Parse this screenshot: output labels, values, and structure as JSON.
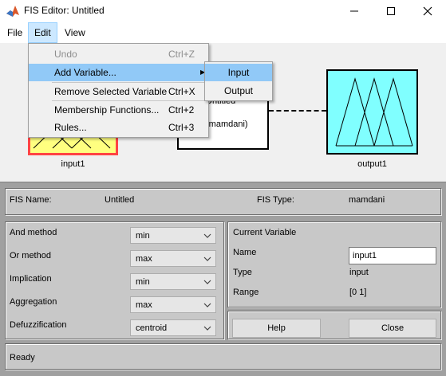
{
  "window": {
    "title": "FIS Editor: Untitled"
  },
  "menubar": {
    "file": "File",
    "edit": "Edit",
    "view": "View"
  },
  "edit_menu": {
    "items": [
      {
        "label": "Undo",
        "shortcut": "Ctrl+Z",
        "disabled": true
      },
      {
        "label": "Add Variable...",
        "shortcut": "",
        "submenu_arrow": "▶"
      },
      {
        "label": "Remove Selected Variable",
        "shortcut": "Ctrl+X"
      },
      {
        "label": "Membership Functions...",
        "shortcut": "Ctrl+2"
      },
      {
        "label": "Rules...",
        "shortcut": "Ctrl+3"
      }
    ]
  },
  "add_variable_submenu": {
    "items": [
      "Input",
      "Output"
    ]
  },
  "diagram": {
    "input_label": "input1",
    "center_name_partial": "Untitled",
    "center_type_partial": "(mamdani)",
    "output_label": "output1"
  },
  "fis": {
    "name_label": "FIS Name:",
    "name_value": "Untitled",
    "type_label": "FIS Type:",
    "type_value": "mamdani"
  },
  "methods": [
    {
      "label": "And method",
      "value": "min"
    },
    {
      "label": "Or method",
      "value": "max"
    },
    {
      "label": "Implication",
      "value": "min"
    },
    {
      "label": "Aggregation",
      "value": "max"
    },
    {
      "label": "Defuzzification",
      "value": "centroid"
    }
  ],
  "current_variable": {
    "heading": "Current Variable",
    "name_label": "Name",
    "name_value": "input1",
    "type_label": "Type",
    "type_value": "input",
    "range_label": "Range",
    "range_value": "[0 1]"
  },
  "buttons": {
    "help": "Help",
    "close": "Close"
  },
  "status": "Ready",
  "colors": {
    "input_fill": "#ffff80",
    "output_fill": "#80ffff",
    "selection_border": "#ff4444",
    "menu_highlight": "#91c9f7"
  }
}
